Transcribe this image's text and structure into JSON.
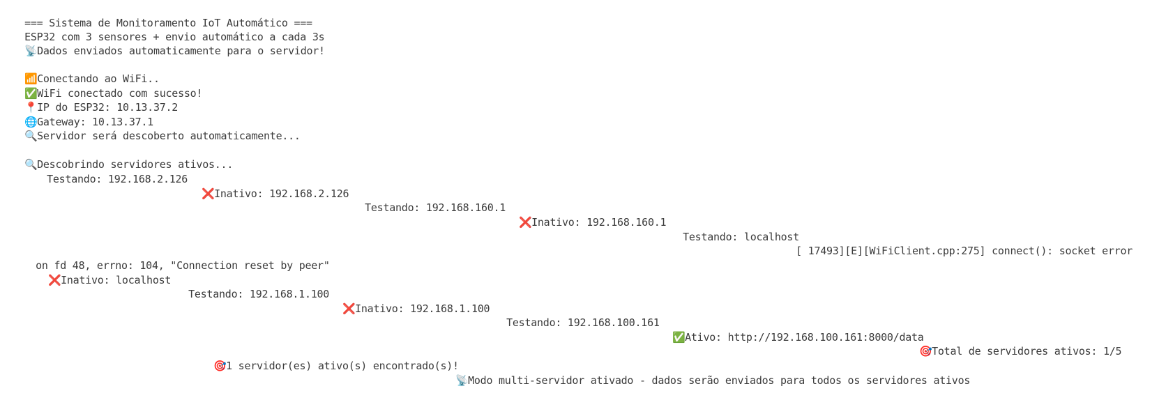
{
  "terminal": {
    "lines": {
      "l0": {
        "text": "=== Sistema de Monitoramento IoT Automático ==="
      },
      "l1": {
        "text": "ESP32 com 3 sensores + envio automático a cada 3s"
      },
      "l2": {
        "icon": "📡",
        "text": "Dados enviados automaticamente para o servidor!"
      },
      "l4": {
        "icon": "📶",
        "text": "Conectando ao WiFi.."
      },
      "l5": {
        "icon": "✅",
        "text": "WiFi conectado com sucesso!"
      },
      "l6": {
        "icon": "📍",
        "text": "IP do ESP32: 10.13.37.2"
      },
      "l7": {
        "icon": "🌐",
        "text": "Gateway: 10.13.37.1"
      },
      "l8": {
        "icon": "🔍",
        "text": "Servidor será descoberto automaticamente..."
      },
      "l10": {
        "icon": "🔍",
        "text": "Descobrindo servidores ativos..."
      },
      "l11": {
        "text": "Testando: 192.168.2.126"
      },
      "l12": {
        "icon": "❌",
        "text": "Inativo: 192.168.2.126"
      },
      "l13": {
        "text": "Testando: 192.168.160.1"
      },
      "l14": {
        "icon": "❌",
        "text": "Inativo: 192.168.160.1"
      },
      "l15": {
        "text": "Testando: localhost"
      },
      "l16": {
        "text": "[ 17493][E][WiFiClient.cpp:275] connect(): socket error"
      },
      "l17": {
        "text": "on fd 48, errno: 104, \"Connection reset by peer\""
      },
      "l18": {
        "icon": "❌",
        "text": "Inativo: localhost"
      },
      "l19": {
        "text": "Testando: 192.168.1.100"
      },
      "l20": {
        "icon": "❌",
        "text": "Inativo: 192.168.1.100"
      },
      "l21": {
        "text": "Testando: 192.168.100.161"
      },
      "l22": {
        "icon": "✅",
        "text": "Ativo: http://192.168.100.161:8000/data"
      },
      "l23": {
        "icon": "🎯",
        "text": "Total de servidores ativos: 1/5"
      },
      "l24": {
        "icon": "🎯",
        "text": "1 servidor(es) ativo(s) encontrado(s)!"
      },
      "l25": {
        "icon": "📡",
        "text": "Modo multi-servidor ativado - dados serão enviados para todos os servidores ativos"
      }
    }
  }
}
